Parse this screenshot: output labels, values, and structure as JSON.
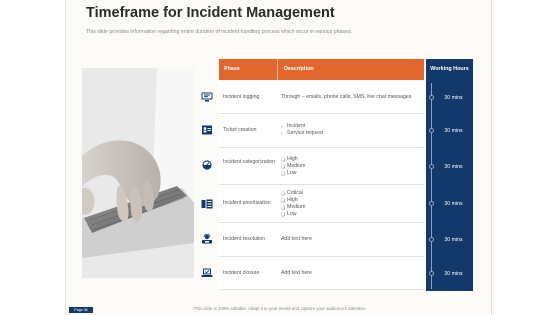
{
  "slide": {
    "title": "Timeframe for Incident Management",
    "subtitle": "This slide provides information regarding entire duration of incident handling process which occur in various phases.",
    "footer": "This slide is 100% editable. Adapt it to your needs and capture your audience's attention.",
    "page_tag": "Page 06"
  },
  "table": {
    "headers": {
      "phase": "Phase",
      "description": "Description",
      "working_hours": "Working Hours"
    },
    "rows": [
      {
        "icon": "monitor-icon",
        "phase": "Incident logging",
        "description": [
          "Through – emails, phone calls, SMS, live chat messages"
        ],
        "time": "30 mins"
      },
      {
        "icon": "id-card-icon",
        "phase": "Ticket creation",
        "bullet": "›",
        "description": [
          "Incident",
          "Service request"
        ],
        "time": "30 mins"
      },
      {
        "icon": "gauge-icon",
        "phase": "Incident categorization",
        "bullet": "❏",
        "description": [
          "High",
          "Medium",
          "Low"
        ],
        "time": "30 mins"
      },
      {
        "icon": "priority-list-icon",
        "phase": "Incident prioritization",
        "bullet": "❏",
        "description": [
          "Critical",
          "High",
          "Medium",
          "Low"
        ],
        "time": "30 mins"
      },
      {
        "icon": "support-agent-icon",
        "phase": "Incident resolution",
        "description": [
          "Add text here"
        ],
        "time": "30 mins"
      },
      {
        "icon": "laptop-check-icon",
        "phase": "Incident closure",
        "description": [
          "Add text here"
        ],
        "time": "30 mins"
      }
    ]
  },
  "colors": {
    "header_orange": "#e2672e",
    "navy": "#13386a",
    "background": "#fdfbf7"
  }
}
